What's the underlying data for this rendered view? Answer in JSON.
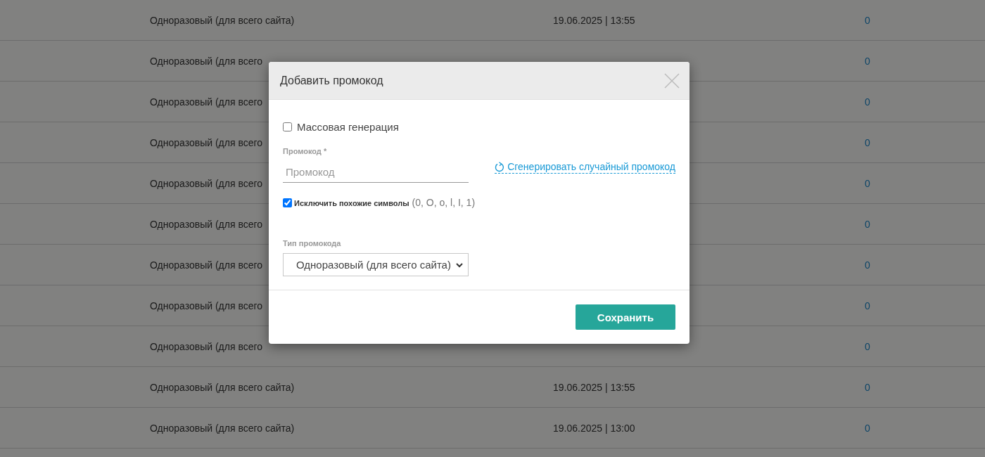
{
  "table": {
    "rows": [
      {
        "type": "Одноразовый (для всего сайта)",
        "date": "19.06.2025 | 13:55",
        "count": "0"
      },
      {
        "type": "Одноразовый (для всего",
        "count": "0"
      },
      {
        "type": "Одноразовый (для всего",
        "count": "0"
      },
      {
        "type": "Одноразовый (для всего",
        "count": "0"
      },
      {
        "type": "Одноразовый (для всего",
        "count": "0"
      },
      {
        "type": "Одноразовый (для всего",
        "count": "0"
      },
      {
        "type": "Одноразовый (для всего",
        "count": "0"
      },
      {
        "type": "Одноразовый (для всего",
        "count": "0"
      },
      {
        "type": "Одноразовый (для всего",
        "count": "0"
      },
      {
        "type": "Одноразовый (для всего сайта)",
        "date": "19.06.2025 | 13:55",
        "count": "0"
      },
      {
        "type": "Одноразовый (для всего сайта)",
        "date": "19.06.2025 | 13:00",
        "count": "0"
      }
    ]
  },
  "modal": {
    "title": "Добавить промокод",
    "mass_generation": {
      "label": "Массовая генерация",
      "checked": false
    },
    "promo_code": {
      "label": "Промокод *",
      "placeholder": "Промокод"
    },
    "generate_link": "Сгенерировать случайный промокод",
    "exclude_similar": {
      "label": "**Исключить похожие символы** (0, O, o, l, I, 1)",
      "checked": true
    },
    "promo_type": {
      "label": "Тип промокода",
      "value": "Одноразовый (для всего сайта)"
    },
    "save_button": "Сохранить"
  }
}
